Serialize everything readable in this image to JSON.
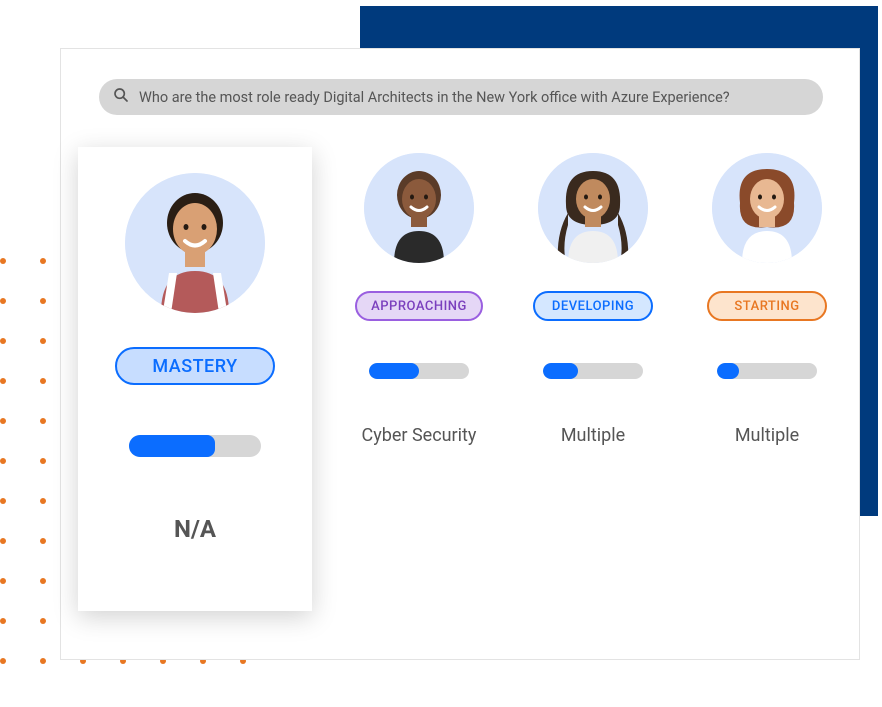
{
  "search": {
    "query": "Who are the most role ready Digital Architects in the New York office with Azure Experience?"
  },
  "colors": {
    "accent_orange": "#e87722",
    "panel_blue": "#003a7d",
    "progress_blue": "#0b6dff"
  },
  "featured": {
    "level_label": "MASTERY",
    "level_text_color": "#0b6dff",
    "level_bg": "#c7ddff",
    "level_border": "#0b6dff",
    "progress_pct": 65,
    "specialty": "N/A"
  },
  "candidates": [
    {
      "level_label": "APPROACHING",
      "level_text_color": "#7a3fbd",
      "level_bg": "#e5d7f6",
      "level_border": "#9a5fe0",
      "progress_pct": 50,
      "specialty": "Cyber Security"
    },
    {
      "level_label": "DEVELOPING",
      "level_text_color": "#0b6dff",
      "level_bg": "#d4e7ff",
      "level_border": "#0b6dff",
      "progress_pct": 35,
      "specialty": "Multiple"
    },
    {
      "level_label": "STARTING",
      "level_text_color": "#e87722",
      "level_bg": "#fde4cd",
      "level_border": "#e87722",
      "progress_pct": 22,
      "specialty": "Multiple"
    }
  ]
}
